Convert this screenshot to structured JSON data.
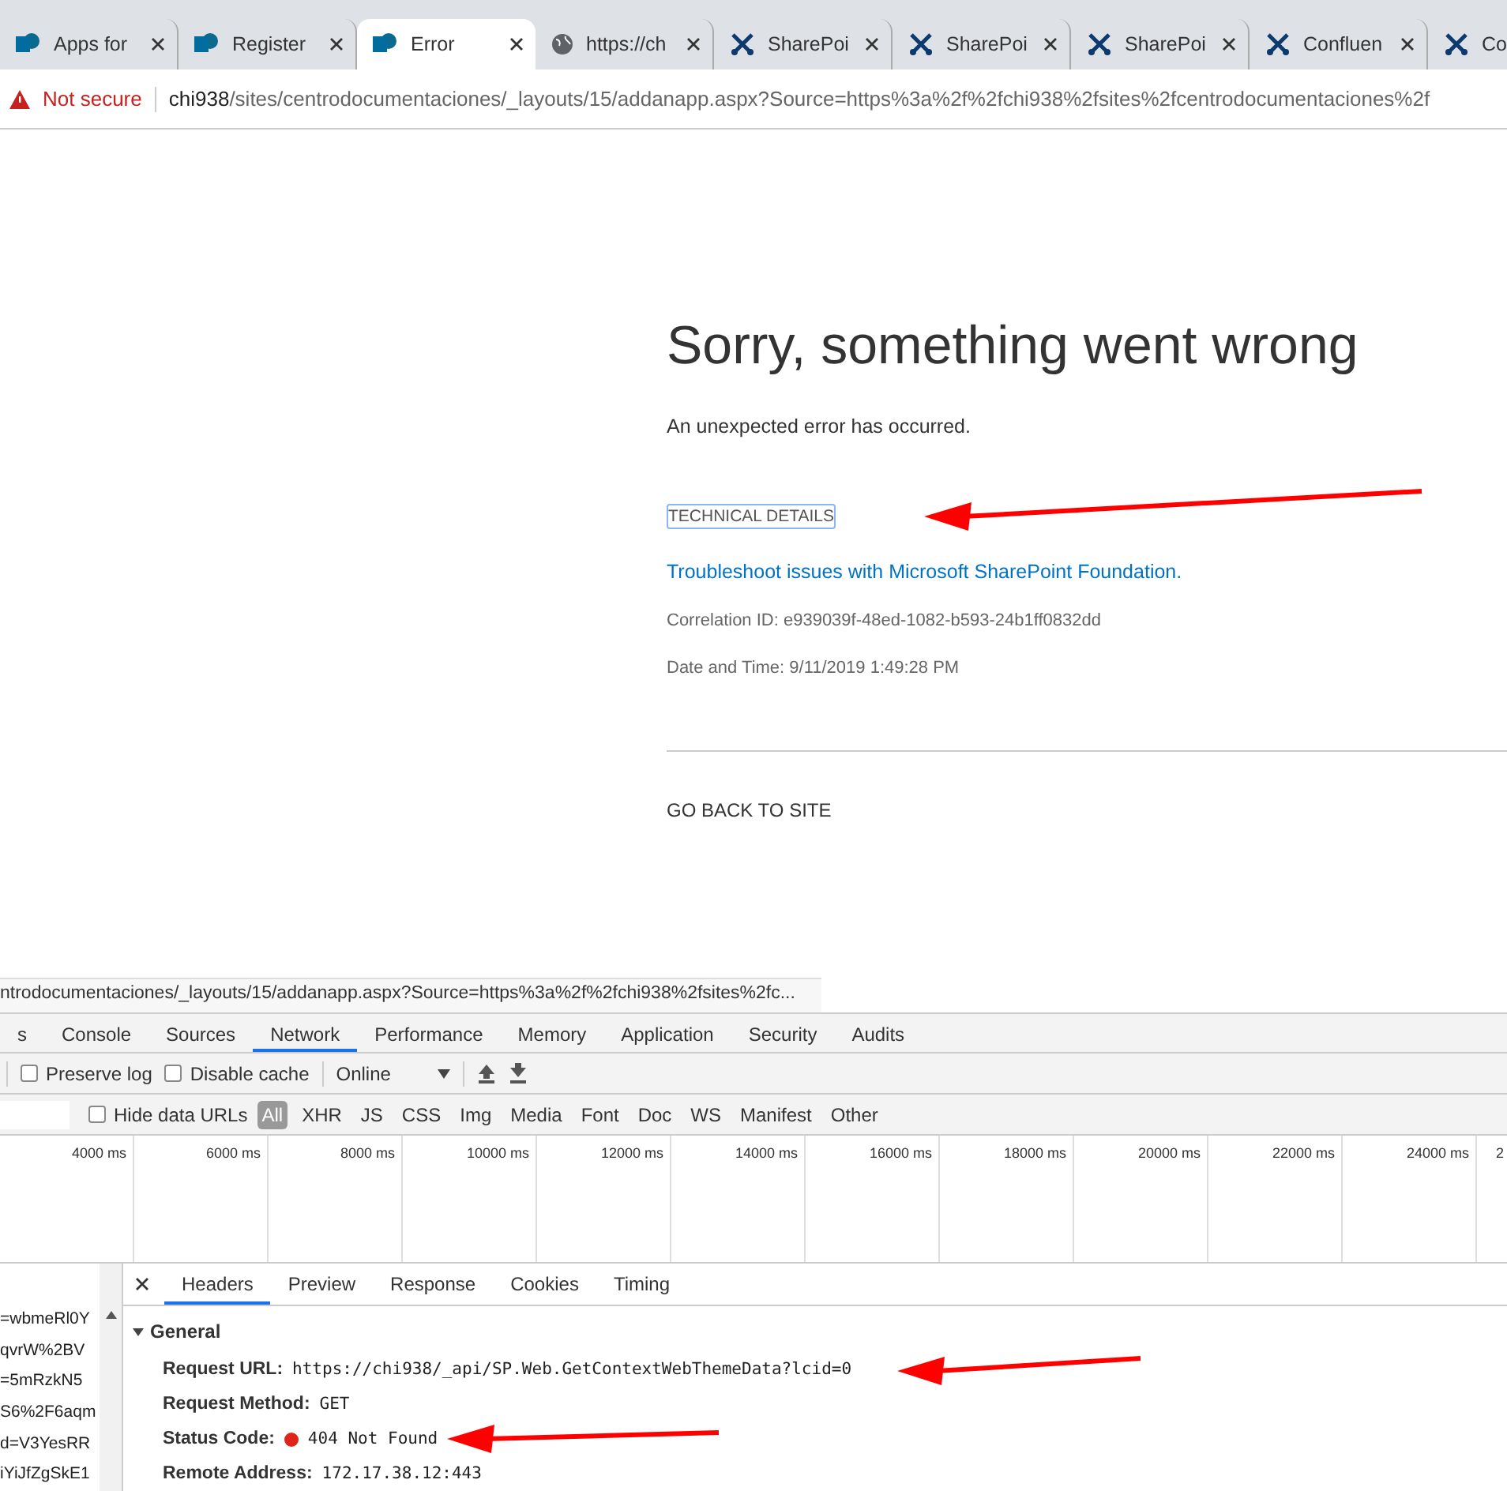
{
  "browser_tabs": [
    {
      "kind": "sharepoint",
      "label": "Apps for",
      "selected": false
    },
    {
      "kind": "sharepoint",
      "label": "Register",
      "selected": false
    },
    {
      "kind": "sharepoint",
      "label": "Error",
      "selected": true
    },
    {
      "kind": "globe",
      "label": "https://ch",
      "selected": false
    },
    {
      "kind": "tool",
      "label": "SharePoi",
      "selected": false
    },
    {
      "kind": "tool",
      "label": "SharePoi",
      "selected": false
    },
    {
      "kind": "tool",
      "label": "SharePoi",
      "selected": false
    },
    {
      "kind": "tool",
      "label": "Confluen",
      "selected": false
    },
    {
      "kind": "tool",
      "label": "Co",
      "selected": false
    }
  ],
  "address_bar": {
    "security": "Not secure",
    "host": "chi938",
    "path": "/sites/centrodocumentaciones/_layouts/15/addanapp.aspx?Source=https%3a%2f%2fchi938%2fsites%2fcentrodocumentaciones%2f"
  },
  "error_page": {
    "title": "Sorry, something went wrong",
    "message": "An unexpected error has occurred.",
    "technical_details": "TECHNICAL DETAILS",
    "troubleshoot_link": "Troubleshoot issues with Microsoft SharePoint Foundation.",
    "correlation_id": "Correlation ID: e939039f-48ed-1082-b593-24b1ff0832dd",
    "date_time": "Date and Time: 9/11/2019 1:49:28 PM",
    "go_back": "GO BACK TO SITE"
  },
  "status_url": "ntrodocumentaciones/_layouts/15/addanapp.aspx?Source=https%3a%2f%2fchi938%2fsites%2fc...",
  "devtools": {
    "tabs": [
      {
        "label": "s",
        "selected": false
      },
      {
        "label": "Console",
        "selected": false
      },
      {
        "label": "Sources",
        "selected": false
      },
      {
        "label": "Network",
        "selected": true
      },
      {
        "label": "Performance",
        "selected": false
      },
      {
        "label": "Memory",
        "selected": false
      },
      {
        "label": "Application",
        "selected": false
      },
      {
        "label": "Security",
        "selected": false
      },
      {
        "label": "Audits",
        "selected": false
      }
    ],
    "preserve_log": {
      "label": "Preserve log",
      "checked": false
    },
    "disable_cache": {
      "label": "Disable cache",
      "checked": false
    },
    "throttling": "Online",
    "hide_data_urls": {
      "label": "Hide data URLs",
      "checked": false
    },
    "filters": [
      {
        "label": "All",
        "selected": true
      },
      {
        "label": "XHR",
        "selected": false
      },
      {
        "label": "JS",
        "selected": false
      },
      {
        "label": "CSS",
        "selected": false
      },
      {
        "label": "Img",
        "selected": false
      },
      {
        "label": "Media",
        "selected": false
      },
      {
        "label": "Font",
        "selected": false
      },
      {
        "label": "Doc",
        "selected": false
      },
      {
        "label": "WS",
        "selected": false
      },
      {
        "label": "Manifest",
        "selected": false
      },
      {
        "label": "Other",
        "selected": false
      }
    ],
    "timeline_ticks": [
      "4000 ms",
      "6000 ms",
      "8000 ms",
      "10000 ms",
      "12000 ms",
      "14000 ms",
      "16000 ms",
      "18000 ms",
      "20000 ms",
      "22000 ms",
      "24000 ms",
      "2"
    ],
    "requests": [
      {
        "name": "=wbmeRl0Y",
        "selected": false
      },
      {
        "name": "qvrW%2BV",
        "selected": false
      },
      {
        "name": "=5mRzkN5",
        "selected": false
      },
      {
        "name": "S6%2F6aqm",
        "selected": false
      },
      {
        "name": "d=V3YesRR",
        "selected": false
      },
      {
        "name": "iYiJfZgSkE1",
        "selected": false
      }
    ],
    "detail_tabs": [
      {
        "label": "Headers",
        "selected": true
      },
      {
        "label": "Preview",
        "selected": false
      },
      {
        "label": "Response",
        "selected": false
      },
      {
        "label": "Cookies",
        "selected": false
      },
      {
        "label": "Timing",
        "selected": false
      }
    ],
    "general": {
      "title": "General",
      "expanded": true,
      "rows": [
        {
          "kind": "text",
          "label": "Request URL:",
          "value": "https://chi938/_api/SP.Web.GetContextWebThemeData?lcid=0"
        },
        {
          "kind": "text",
          "label": "Request Method:",
          "value": "GET"
        },
        {
          "kind": "status",
          "label": "Status Code:",
          "value": "404 Not Found",
          "color": "#e0241b"
        },
        {
          "kind": "text",
          "label": "Remote Address:",
          "value": "172.17.38.12:443"
        }
      ]
    }
  }
}
